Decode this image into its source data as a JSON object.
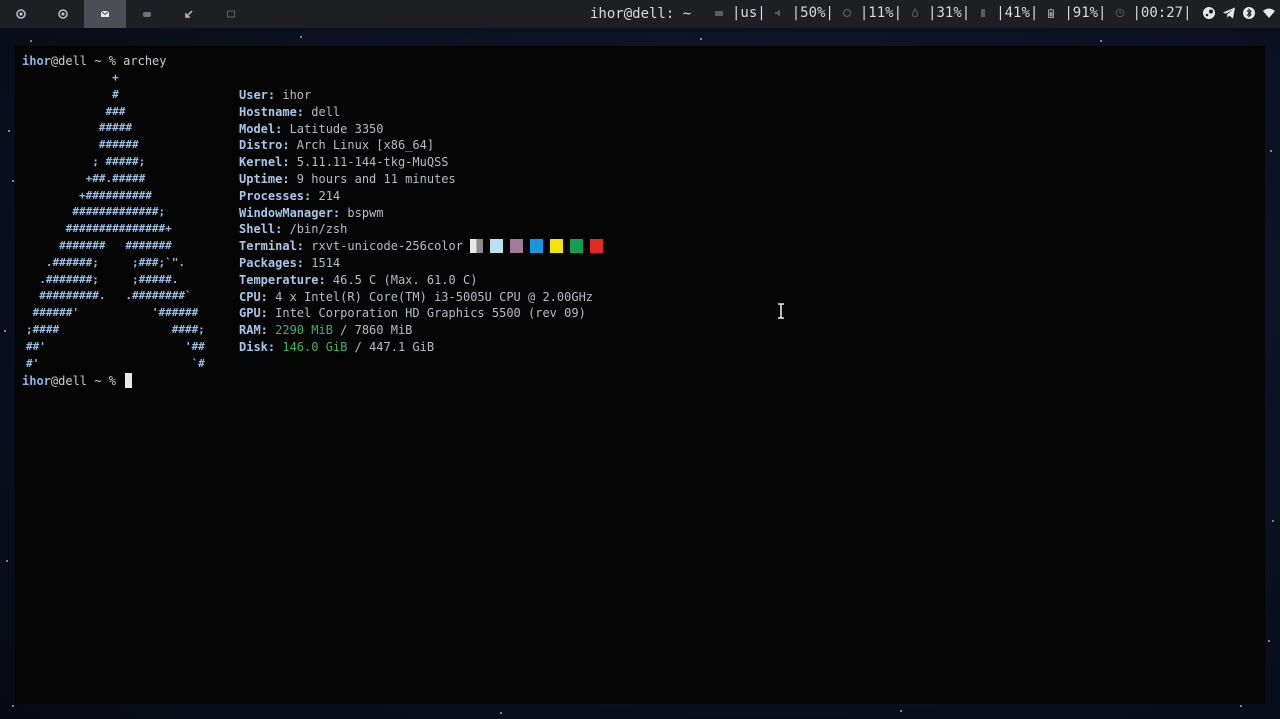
{
  "workspaces": [
    {
      "icon": "circle-dot-icon",
      "active": false
    },
    {
      "icon": "circle-dot-icon",
      "active": false
    },
    {
      "icon": "mail-icon",
      "active": true
    },
    {
      "icon": "gamepad-icon",
      "active": false
    },
    {
      "icon": "arrow-icon",
      "active": false
    },
    {
      "icon": "window-icon",
      "active": false
    }
  ],
  "bar": {
    "title": "ihor@dell: ~",
    "layout": "|us|",
    "volume": "|50%|",
    "cpu": "|11%|",
    "temp": "|31%|",
    "memory": "|41%|",
    "battery": "|91%|",
    "clock": "|00:27|"
  },
  "terminal": {
    "prompt_user": "ihor",
    "prompt_rest": "@dell ~ % ",
    "command": "archey",
    "logo": [
      "             +",
      "             #",
      "            ###",
      "           #####",
      "           ######",
      "          ; #####;",
      "         +##.#####",
      "        +##########",
      "       #############;",
      "      ###############+",
      "     #######   #######",
      "   .######;     ;###;`\".",
      "  .#######;     ;#####.",
      "  #########.   .########`",
      " ######'           '######",
      ";####                 ####;",
      "##'                     '##",
      "#'                       `#"
    ],
    "info": [
      {
        "key": "User:",
        "value": " ihor"
      },
      {
        "key": "Hostname:",
        "value": " dell"
      },
      {
        "key": "Model:",
        "value": " Latitude 3350"
      },
      {
        "key": "Distro:",
        "value": " Arch Linux [x86_64]"
      },
      {
        "key": "Kernel:",
        "value": " 5.11.11-144-tkg-MuQSS"
      },
      {
        "key": "Uptime:",
        "value": " 9 hours and 11 minutes"
      },
      {
        "key": "Processes:",
        "value": " 214"
      },
      {
        "key": "WindowManager:",
        "value": " bspwm"
      },
      {
        "key": "Shell:",
        "value": " /bin/zsh"
      },
      {
        "key": "Terminal:",
        "value": " rxvt-unicode-256color "
      },
      {
        "key": "Packages:",
        "value": " 1514"
      },
      {
        "key": "Temperature:",
        "value": " 46.5 C (Max. 61.0 C)"
      },
      {
        "key": "CPU:",
        "value": " 4 x Intel(R) Core(TM) i3-5005U CPU @ 2.00GHz"
      },
      {
        "key": "GPU:",
        "value": " Intel Corporation HD Graphics 5500 (rev 09)"
      },
      {
        "key": "RAM:",
        "value_green": " 2290 MiB",
        "value": " / 7860 MiB"
      },
      {
        "key": "Disk:",
        "value_green": " 146.0 GiB",
        "value": " / 447.1 GiB"
      }
    ],
    "terminal_swatches": [
      "#e8e8e8",
      "#b8e2f2",
      "#a07a9a",
      "#1a96dc",
      "#f2e500",
      "#14a050",
      "#e02a22"
    ]
  }
}
